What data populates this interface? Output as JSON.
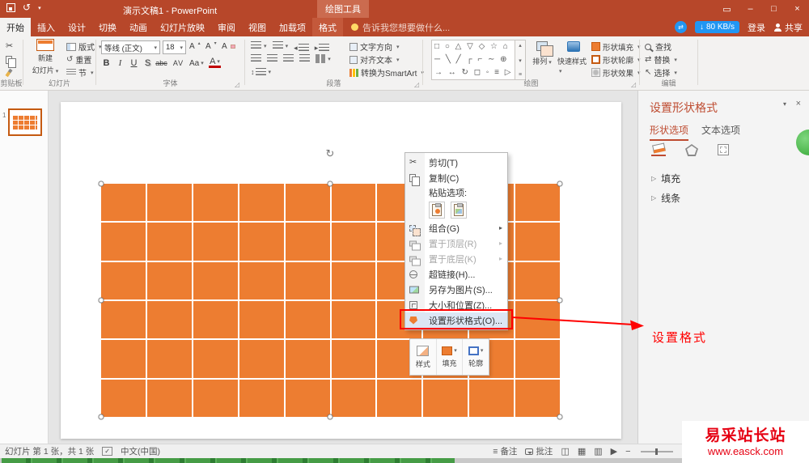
{
  "colors": {
    "brand": "#B7472A",
    "table_fill": "#ED7D31",
    "table_line": "#FFFFFF",
    "annotation_red": "#FF0000",
    "watermark_red": "#E60012",
    "net_badge_blue": "#2196F3",
    "widget_green": "#3CB53C"
  },
  "icons": {
    "dropdown": "▾",
    "submenu_arrow": "▸",
    "scroll_up": "▴",
    "scroll_down": "▾",
    "more": "≡",
    "cut": "✂",
    "undo": "↺",
    "reset": "↺",
    "rotate_handle": "↻",
    "down_arrow": "↓",
    "sync": "⇄",
    "replace": "⇄",
    "select_cursor": "↖",
    "outdent": "◂",
    "indent": "▸",
    "line_spacing": "↕",
    "check": "✓",
    "notes": "≡",
    "minimize": "–",
    "maximize": "□",
    "close": "×",
    "ribbon_options": "▭",
    "dialog_launcher": "◿",
    "section_arrow": "▷",
    "view_normal": "◫",
    "view_sorter": "▦",
    "view_reading": "▥",
    "view_slideshow": "▶",
    "zoom_out": "−",
    "zoom_in": "+"
  },
  "title_bar": {
    "title": "演示文稿1 - PowerPoint",
    "context_tool_header": "绘图工具"
  },
  "tab_row": {
    "tabs": [
      "开始",
      "插入",
      "设计",
      "切换",
      "动画",
      "幻灯片放映",
      "审阅",
      "视图",
      "加载项",
      "格式"
    ],
    "active_tab": "开始",
    "contextual_tab": "格式",
    "tell_me": "告诉我您想要做什么...",
    "net_speed": "80 KB/s",
    "sign_in": "登录",
    "share": "共享"
  },
  "ribbon": {
    "clipboard": {
      "label": "剪贴板"
    },
    "slides": {
      "new_slide_line1": "新建",
      "new_slide_line2": "幻灯片",
      "layout": "版式",
      "reset": "重置",
      "section": "节",
      "label": "幻灯片"
    },
    "font": {
      "name": "等线 (正文)",
      "size": "18",
      "grow": "A",
      "shrink": "A",
      "clear": "A",
      "bold": "B",
      "italic": "I",
      "underline": "U",
      "shadow": "S",
      "strikethrough": "abc",
      "char_spacing": "AV",
      "change_case": "Aa",
      "font_color": "A",
      "label": "字体"
    },
    "paragraph": {
      "text_direction": "文字方向",
      "align_text": "对齐文本",
      "smartart": "转换为SmartArt",
      "label": "段落"
    },
    "drawing": {
      "shape_rows": [
        "□ ○ △ ▽ ◇ ☆ ⌂",
        "─ ╲ ╱ ┌ ⌐ ∼ ⊕",
        "→ ↔ ↻ ◻ ◦ ≡ ▷"
      ],
      "arrange": "排列",
      "quick_styles": "快速样式",
      "shape_fill": "形状填充",
      "shape_outline": "形状轮廓",
      "shape_effects": "形状效果",
      "label": "绘图"
    },
    "editing": {
      "find": "查找",
      "replace": "替换",
      "select": "选择",
      "label": "编辑"
    }
  },
  "slide_panel": {
    "slide_number": "1"
  },
  "slide": {
    "table": {
      "rows": 6,
      "cols": 10
    }
  },
  "context_menu": {
    "items": [
      {
        "label": "剪切(T)"
      },
      {
        "label": "复制(C)"
      },
      {
        "label": "粘贴选项:"
      },
      {
        "label": ""
      },
      {
        "label": "组合(G)"
      },
      {
        "label": "置于顶层(R)"
      },
      {
        "label": "置于底层(K)"
      },
      {
        "label": "超链接(H)..."
      },
      {
        "label": "另存为图片(S)..."
      },
      {
        "label": "大小和位置(Z)..."
      },
      {
        "label": "设置形状格式(O)..."
      }
    ]
  },
  "mini_toolbar": {
    "style": "样式",
    "fill": "填充",
    "outline": "轮廓"
  },
  "annotation": {
    "label": "设置格式"
  },
  "format_pane": {
    "title": "设置形状格式",
    "tabs": [
      "形状选项",
      "文本选项"
    ],
    "sections": [
      "填充",
      "线条"
    ]
  },
  "status_bar": {
    "slide_info": "幻灯片 第 1 张，共 1 张",
    "language": "中文(中国)",
    "notes": "备注",
    "comments": "批注"
  },
  "watermark": {
    "line1": "易采站长站",
    "line2": "www.easck.com"
  }
}
